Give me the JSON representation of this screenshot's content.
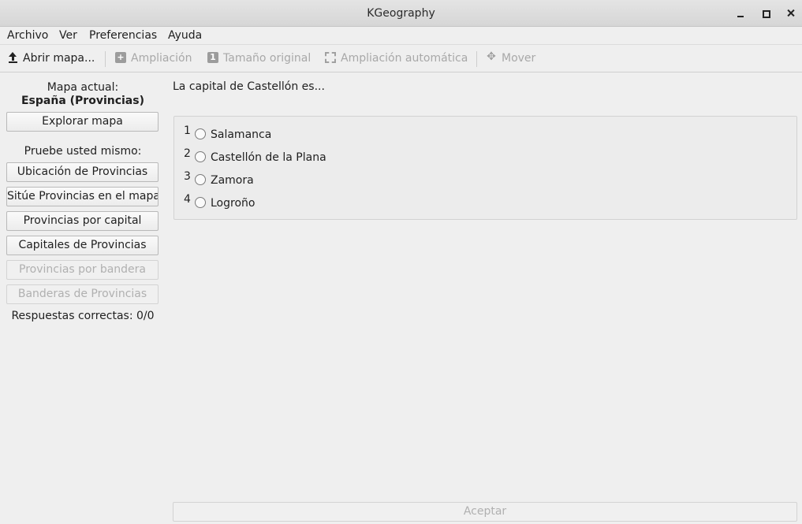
{
  "window": {
    "title": "KGeography"
  },
  "menubar": {
    "items": [
      "Archivo",
      "Ver",
      "Preferencias",
      "Ayuda"
    ]
  },
  "toolbar": {
    "open_map": "Abrir mapa...",
    "zoom": "Ampliación",
    "original_size": "Tamaño original",
    "auto_zoom": "Ampliación automática",
    "move": "Mover"
  },
  "sidebar": {
    "current_map_label": "Mapa actual:",
    "current_map_name": "España (Provincias)",
    "explore_button": "Explorar mapa",
    "test_yourself_label": "Pruebe usted mismo:",
    "quiz_buttons": [
      {
        "label": "Ubicación de Provincias",
        "enabled": true
      },
      {
        "label": "Sitúe Provincias en el mapa",
        "enabled": true
      },
      {
        "label": "Provincias por capital",
        "enabled": true
      },
      {
        "label": "Capitales de Provincias",
        "enabled": true
      },
      {
        "label": "Provincias por bandera",
        "enabled": false
      },
      {
        "label": "Banderas de Provincias",
        "enabled": false
      }
    ],
    "correct_answers": "Respuestas correctas: 0/0"
  },
  "quiz": {
    "question": "La capital de Castellón es...",
    "options": [
      {
        "number": "1",
        "label": "Salamanca"
      },
      {
        "number": "2",
        "label": "Castellón de la Plana"
      },
      {
        "number": "3",
        "label": "Zamora"
      },
      {
        "number": "4",
        "label": "Logroño"
      }
    ],
    "accept_button": "Aceptar"
  }
}
